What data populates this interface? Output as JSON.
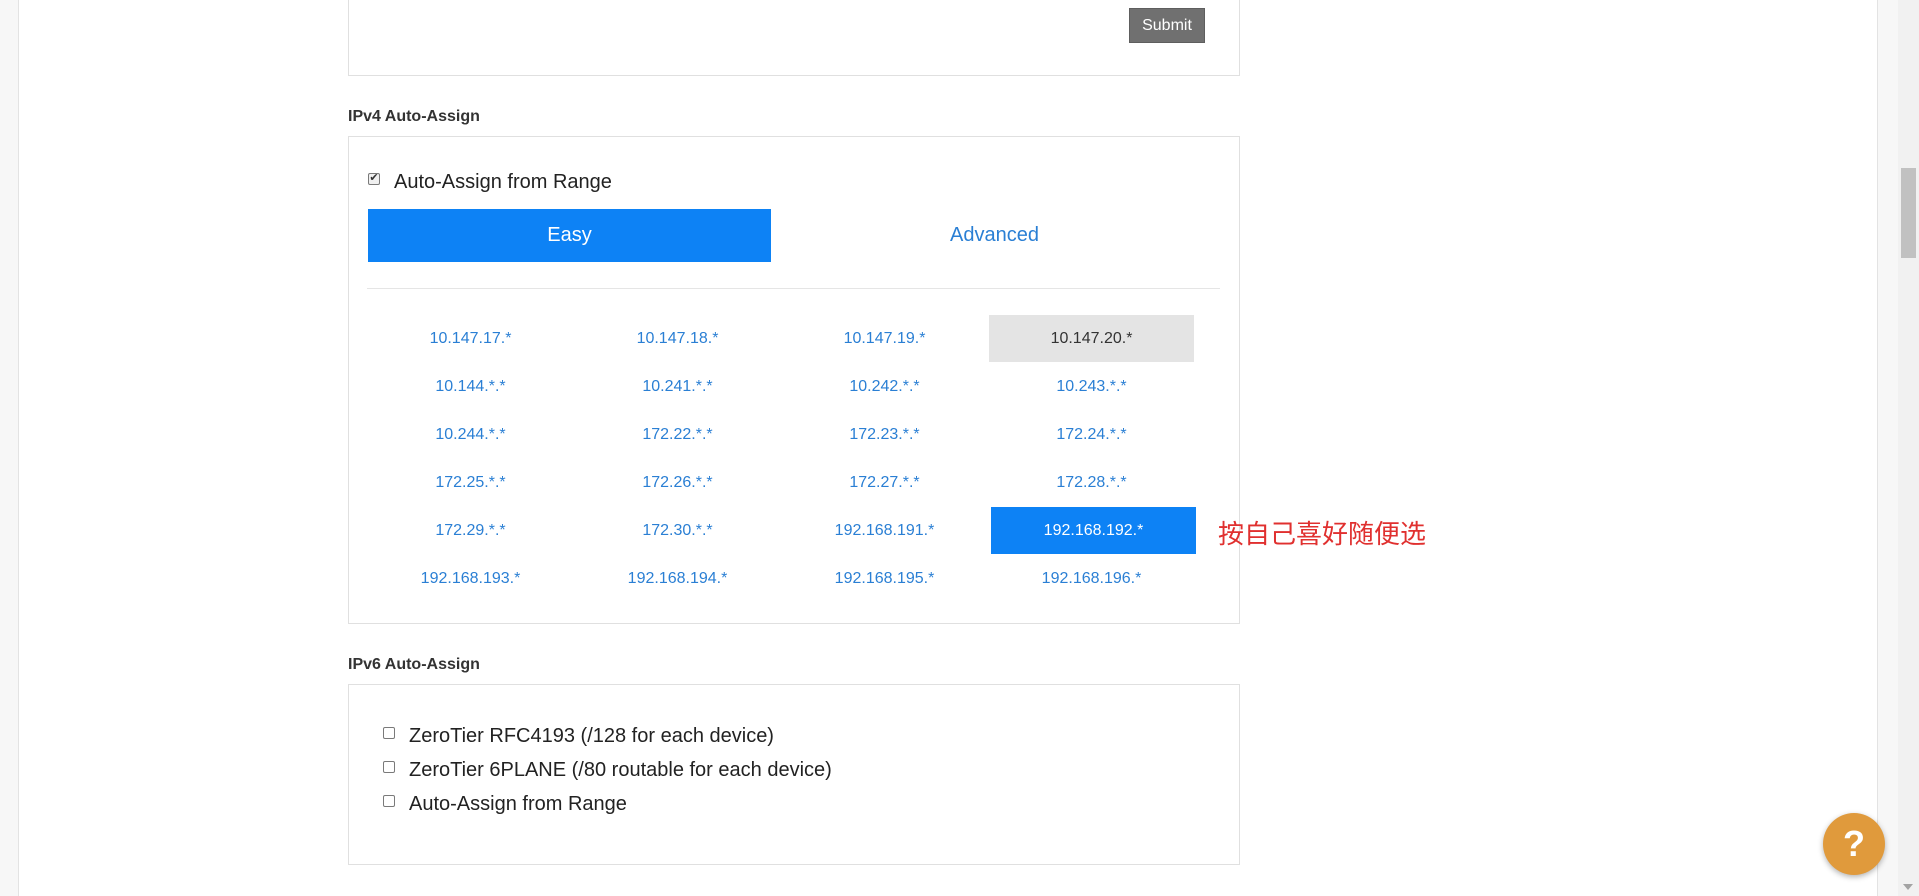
{
  "top_panel": {
    "submit_label": "Submit"
  },
  "ipv4": {
    "heading": "IPv4 Auto-Assign",
    "auto_assign_label": "Auto-Assign from Range",
    "auto_assign_checked": true,
    "tabs": [
      {
        "label": "Easy",
        "active": true
      },
      {
        "label": "Advanced",
        "active": false
      }
    ],
    "ranges": [
      [
        "10.147.17.*",
        "10.147.18.*",
        "10.147.19.*",
        "10.147.20.*"
      ],
      [
        "10.144.*.*",
        "10.241.*.*",
        "10.242.*.*",
        "10.243.*.*"
      ],
      [
        "10.244.*.*",
        "172.22.*.*",
        "172.23.*.*",
        "172.24.*.*"
      ],
      [
        "172.25.*.*",
        "172.26.*.*",
        "172.27.*.*",
        "172.28.*.*"
      ],
      [
        "172.29.*.*",
        "172.30.*.*",
        "192.168.191.*",
        "192.168.192.*"
      ],
      [
        "192.168.193.*",
        "192.168.194.*",
        "192.168.195.*",
        "192.168.196.*"
      ]
    ],
    "hovered_range": "10.147.20.*",
    "selected_range": "192.168.192.*",
    "annotation": "按自己喜好随便选"
  },
  "ipv6": {
    "heading": "IPv6 Auto-Assign",
    "options": [
      {
        "label": "ZeroTier RFC4193 (/128 for each device)",
        "checked": false
      },
      {
        "label": "ZeroTier 6PLANE (/80 routable for each device)",
        "checked": false
      },
      {
        "label": "Auto-Assign from Range",
        "checked": false
      }
    ]
  },
  "help_button": {
    "label": "?"
  },
  "colors": {
    "accent": "#0d82f5",
    "link": "#2a7fd4",
    "annotation": "#e0302f",
    "help": "#e09a3c"
  }
}
